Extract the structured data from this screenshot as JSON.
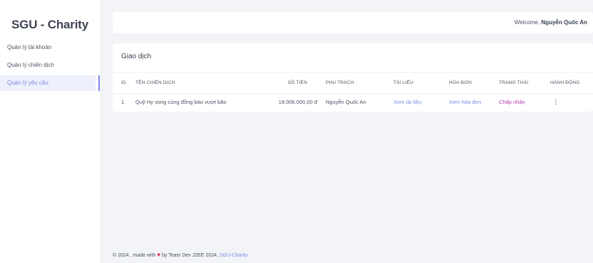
{
  "sidebar": {
    "brand": "SGU - Charity",
    "items": [
      {
        "label": "Quản lý tài khoản"
      },
      {
        "label": "Quản lý chiến dịch"
      },
      {
        "label": "Quản lý yêu cầu"
      }
    ],
    "active_index": 2
  },
  "header": {
    "welcome_prefix": "Welcome,",
    "user_name": "Nguyễn Quốc An"
  },
  "transactions": {
    "title": "Giao dịch",
    "columns": [
      "ID",
      "TÊN CHIẾN DỊCH",
      "SỐ TIỀN",
      "PHỤ TRÁCH",
      "TÀI LIỆU",
      "HÓA ĐƠN",
      "TRẠNG THÁI",
      "HÀNH ĐỘNG"
    ],
    "rows": [
      {
        "id": "1",
        "campaign": "Quỹ Hy vọng cùng đồng bào vượt bão",
        "amount": "18.006.000,00 đ",
        "owner": "Nguyễn Quốc An",
        "document": "Xem tài liệu",
        "invoice": "Xem hóa đơn",
        "status": "Chấp nhận",
        "action": "⋮"
      }
    ]
  },
  "footer": {
    "prefix": "© 2024 , made with",
    "heart": "♥",
    "middle": "by Team Dev J2EE 2024,",
    "link": "SGU-Charity"
  },
  "colors": {
    "accent": "#7d8ae8",
    "status_accept": "#b53ab0",
    "heart": "#e11d48",
    "background": "#f3f4f7"
  }
}
